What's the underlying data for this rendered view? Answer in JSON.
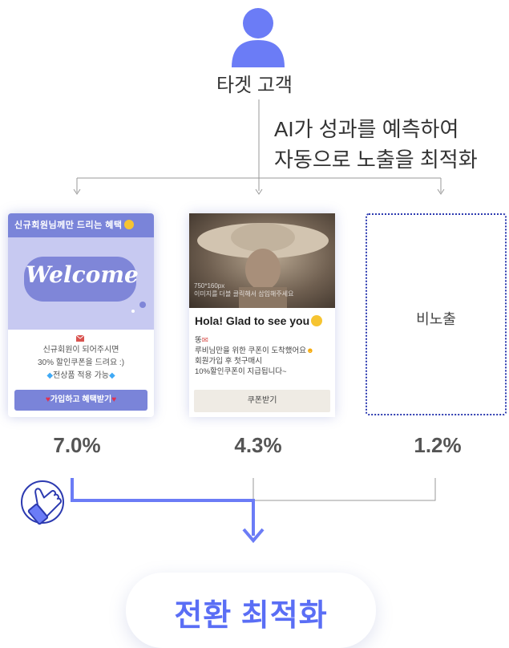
{
  "header": {
    "target_label": "타겟 고객",
    "ai_line1": "AI가 성과를 예측하여",
    "ai_line2": "자동으로 노출을 최적화"
  },
  "cards": [
    {
      "header": "신규회원님께만 드리는 혜택",
      "banner_text": "Welcome",
      "lines": [
        "신규회원이 되어주시면",
        "30% 할인쿠폰을 드려요 :)",
        "전상품 적용 가능"
      ],
      "button": "가입하고 혜택받기",
      "rate": "7.0%"
    },
    {
      "image_caption_1": "750*160px",
      "image_caption_2": "이미지를 더블 클릭해서 삽입해주세요",
      "title": "Hola! Glad to see you",
      "lines": [
        "똥",
        "루비님만을 위한 쿠폰이 도착했어요",
        "회원가입 후 첫구매시",
        "10%할인쿠폰이 지급됩니다~"
      ],
      "button": "쿠폰받기",
      "rate": "4.3%"
    },
    {
      "label": "비노출",
      "rate": "1.2%"
    }
  ],
  "result": {
    "label": "전환 최적화"
  },
  "colors": {
    "accent": "#6b7cf6",
    "card_purple": "#7a84d9",
    "banner_bg": "#c7c9f1",
    "result_text": "#5a6ef5",
    "dotted_border": "#2c3ab0"
  },
  "icons": [
    "user-icon",
    "mail-icon",
    "emoji-icon",
    "thumbs-up-icon",
    "arrow-down-icon"
  ]
}
